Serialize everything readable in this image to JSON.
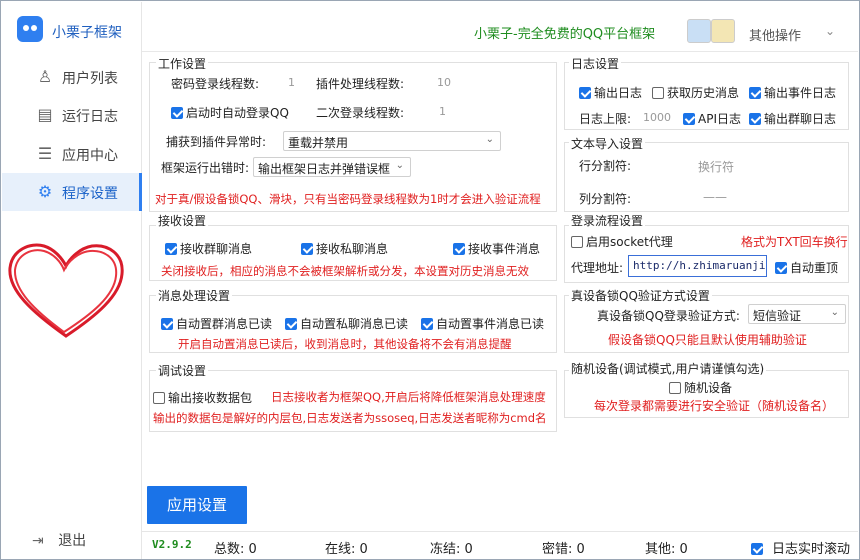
{
  "app": {
    "name": "小栗子框架",
    "slogan": "小栗子-完全免费的QQ平台框架",
    "other_ops": "其他操作",
    "version": "V2.9.2"
  },
  "sidebar": {
    "items": [
      {
        "label": "用户列表",
        "icon": "user-icon"
      },
      {
        "label": "运行日志",
        "icon": "document-icon"
      },
      {
        "label": "应用中心",
        "icon": "list-icon"
      },
      {
        "label": "程序设置",
        "icon": "gear-icon"
      }
    ],
    "logout": "退出"
  },
  "work": {
    "title": "工作设置",
    "pwd_threads_label": "密码登录线程数:",
    "pwd_threads": "1",
    "plugin_threads_label": "插件处理线程数:",
    "plugin_threads": "10",
    "autologin": "启动时自动登录QQ",
    "second_threads_label": "二次登录线程数:",
    "second_threads": "1",
    "plugin_err_label": "捕获到插件异常时:",
    "plugin_err_value": "重载并禁用",
    "frame_err_label": "框架运行出错时:",
    "frame_err_value": "输出框架日志并弹错误框",
    "note": "对于真/假设备锁QQ、滑块，只有当密码登录线程数为1时才会进入验证流程"
  },
  "log": {
    "title": "日志设置",
    "output": "输出日志",
    "history": "获取历史消息",
    "event": "输出事件日志",
    "limit_label": "日志上限:",
    "limit": "1000",
    "api": "API日志",
    "group": "输出群聊日志"
  },
  "text_import": {
    "title": "文本导入设置",
    "row_sep_label": "行分割符:",
    "row_sep": "换行符",
    "col_sep_label": "列分割符:",
    "col_sep": "——"
  },
  "receive": {
    "title": "接收设置",
    "group": "接收群聊消息",
    "private": "接收私聊消息",
    "event": "接收事件消息",
    "note": "关闭接收后，相应的消息不会被框架解析或分发，本设置对历史消息无效"
  },
  "login_flow": {
    "title": "登录流程设置",
    "socket": "启用socket代理",
    "format_note": "格式为TXT回车换行",
    "addr_label": "代理地址:",
    "addr": "http://h.zhimaruanjian.com",
    "auto_top": "自动重顶"
  },
  "msg": {
    "title": "消息处理设置",
    "group_read": "自动置群消息已读",
    "private_read": "自动置私聊消息已读",
    "event_read": "自动置事件消息已读",
    "note": "开启自动置消息已读后，收到消息时，其他设备将不会有消息提醒"
  },
  "device_lock": {
    "title": "真设备锁QQ验证方式设置",
    "method_label": "真设备锁QQ登录验证方式:",
    "method": "短信验证",
    "note": "假设备锁QQ只能且默认使用辅助验证"
  },
  "debug": {
    "title": "调试设置",
    "output_pkg": "输出接收数据包",
    "note1": "日志接收者为框架QQ,开启后将降低框架消息处理速度",
    "note2": "输出的数据包是解好的内层包,日志发送者为ssoseq,日志发送者昵称为cmd名"
  },
  "random_dev": {
    "title": "随机设备(调试模式,用户请谨慎勾选)",
    "label": "随机设备",
    "note": "每次登录都需要进行安全验证（随机设备名）"
  },
  "apply": "应用设置",
  "status": {
    "total": "总数: 0",
    "online": "在线: 0",
    "frozen": "冻结: 0",
    "pwd_err": "密错: 0",
    "other": "其他: 0",
    "realtime": "日志实时滚动"
  },
  "colors": {
    "accent": "#1a73e8",
    "warn": "#e02020",
    "slogan": "#1e8c1e"
  }
}
